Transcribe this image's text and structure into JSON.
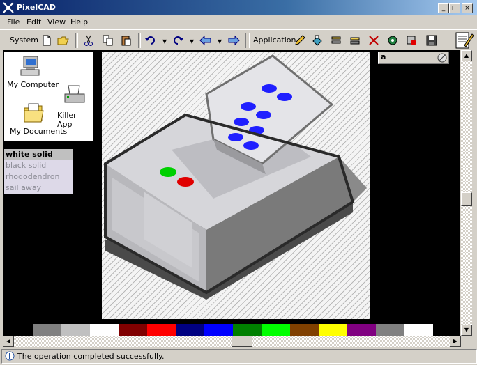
{
  "window": {
    "title": "PixelCAD",
    "minimize_glyph": "_",
    "maximize_glyph": "□",
    "close_glyph": "×"
  },
  "menu": {
    "items": [
      "File",
      "Edit",
      "View",
      "Help"
    ]
  },
  "toolbar": {
    "system_label": "System",
    "application_label": "Application",
    "icons": [
      "new-file-icon",
      "open-folder-icon",
      "cut-icon",
      "copy-icon",
      "paste-icon",
      "undo-icon",
      "redo-icon",
      "back-icon",
      "forward-icon",
      "pencil-icon",
      "tool-1-icon",
      "tool-2-icon",
      "tool-3-icon",
      "tool-4-icon",
      "tool-5-icon",
      "tool-6-icon",
      "save-icon",
      "notepad-icon"
    ]
  },
  "desktop": {
    "items": [
      {
        "label": "My Computer",
        "icon": "computer-icon"
      },
      {
        "label": "Killer App",
        "icon": "printer-icon"
      },
      {
        "label": "My Documents",
        "icon": "documents-icon"
      }
    ]
  },
  "style_list": {
    "items": [
      "white solid",
      "black solid",
      "rhododendron",
      "sail away"
    ],
    "selected": "white solid"
  },
  "side_panel": {
    "header": "a"
  },
  "palette": {
    "colors": [
      "#808080",
      "#c0c0c0",
      "#ffffff",
      "#800000",
      "#ff0000",
      "#000080",
      "#0000ff",
      "#008000",
      "#00ff00",
      "#804000",
      "#ffff00",
      "#800080",
      "#808080",
      "#ffffff"
    ]
  },
  "status": {
    "text": "The operation completed successfully.",
    "icon": "info-icon"
  },
  "colors": {
    "title_bar_start": "#0a246a",
    "title_bar_end": "#a6caf0",
    "chrome": "#d4d0c8",
    "workspace": "#000000"
  }
}
